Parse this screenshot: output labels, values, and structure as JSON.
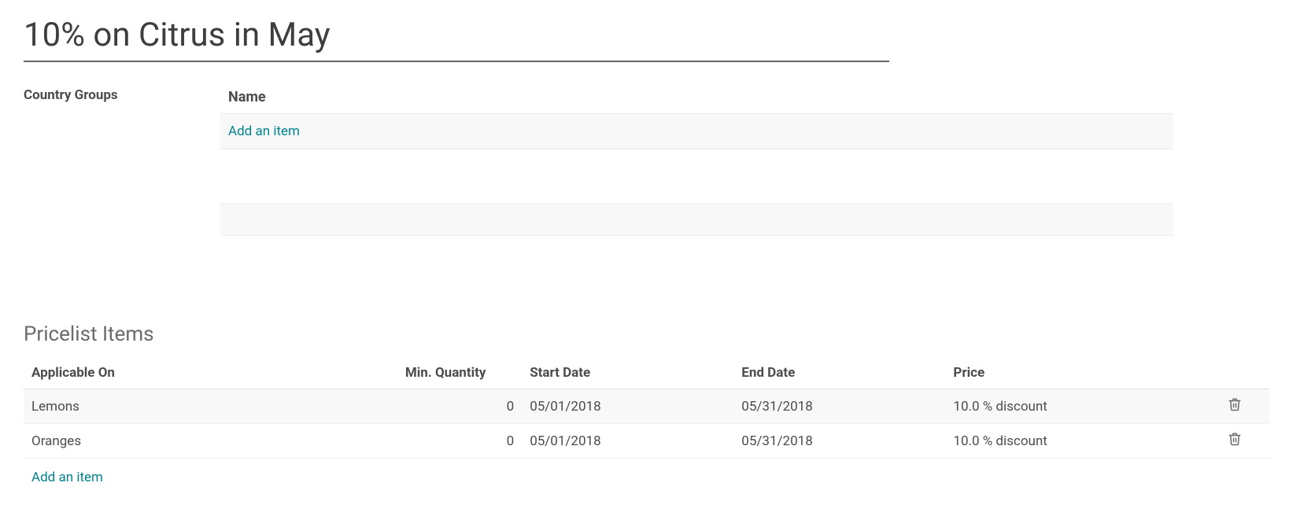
{
  "page": {
    "title": "10% on Citrus in May"
  },
  "country_groups": {
    "label": "Country Groups",
    "header": "Name",
    "add_item_label": "Add an item"
  },
  "pricelist": {
    "section_title": "Pricelist Items",
    "headers": {
      "applicable_on": "Applicable On",
      "min_qty": "Min. Quantity",
      "start_date": "Start Date",
      "end_date": "End Date",
      "price": "Price"
    },
    "rows": [
      {
        "applicable_on": "Lemons",
        "min_qty": "0",
        "start_date": "05/01/2018",
        "end_date": "05/31/2018",
        "price": "10.0 % discount"
      },
      {
        "applicable_on": "Oranges",
        "min_qty": "0",
        "start_date": "05/01/2018",
        "end_date": "05/31/2018",
        "price": "10.0 % discount"
      }
    ],
    "add_item_label": "Add an item"
  }
}
